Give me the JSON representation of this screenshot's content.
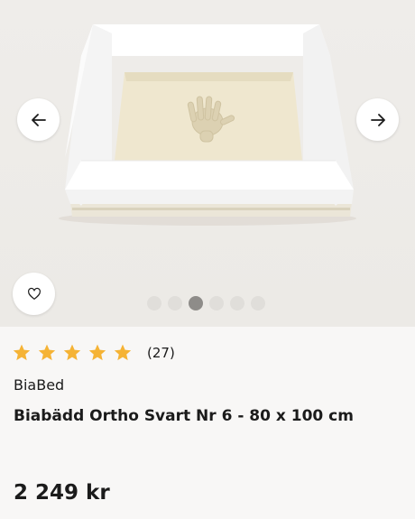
{
  "gallery": {
    "image_alt": "Biabädd Ortho with handprint in foam",
    "prev_icon": "arrow-left-icon",
    "next_icon": "arrow-right-icon",
    "favorite_icon": "heart-outline-icon",
    "dot_count": 6,
    "active_dot": 3
  },
  "product": {
    "rating_stars": 5,
    "review_count": "(27)",
    "brand": "BiaBed",
    "title": "Biabädd Ortho Svart Nr 6 - 80 x 100 cm",
    "price": "2 249 kr"
  },
  "colors": {
    "star": "#f5b335",
    "active_dot": "#8e8c89",
    "inactive_dot": "#e0deda"
  }
}
